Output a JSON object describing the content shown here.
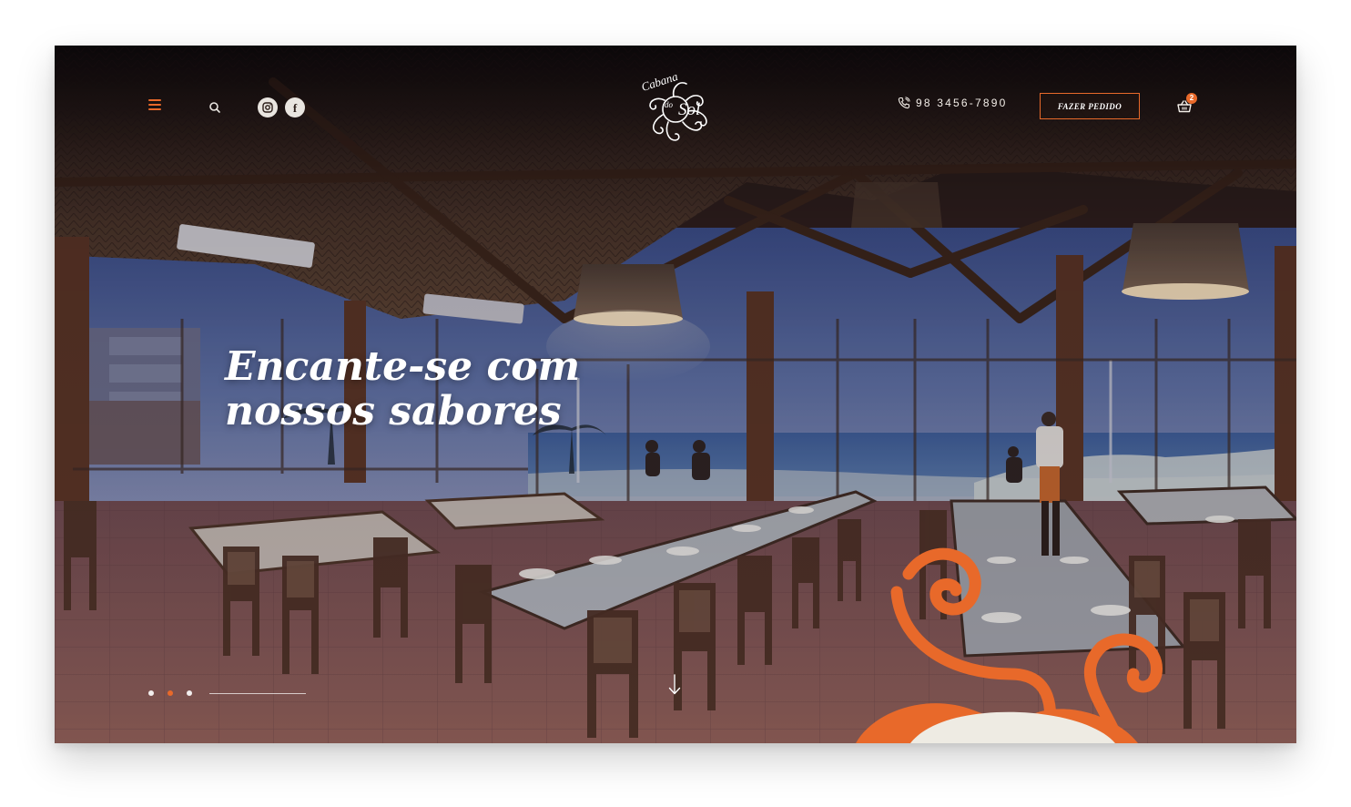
{
  "header": {
    "menu_icon": "hamburger-icon",
    "search_icon": "search-icon",
    "social": [
      {
        "name": "instagram",
        "icon": "instagram-icon"
      },
      {
        "name": "facebook",
        "icon": "facebook-icon",
        "glyph": "f"
      }
    ],
    "logo": {
      "line1": "Cabana",
      "line2": "do",
      "line3": "Sol"
    },
    "phone": {
      "icon": "phone-icon",
      "number": "98 3456-7890"
    },
    "order_button": "FAZER PEDIDO",
    "cart": {
      "icon": "basket-icon",
      "count": "2"
    }
  },
  "hero": {
    "title_line1": "Encante-se com",
    "title_line2": "nossos sabores"
  },
  "slider": {
    "slide_count": 3,
    "active_index": 1
  },
  "scroll_icon": "arrow-down-icon",
  "colors": {
    "accent": "#e8692a",
    "text_light": "#ffffff",
    "background": "#ffffff"
  }
}
